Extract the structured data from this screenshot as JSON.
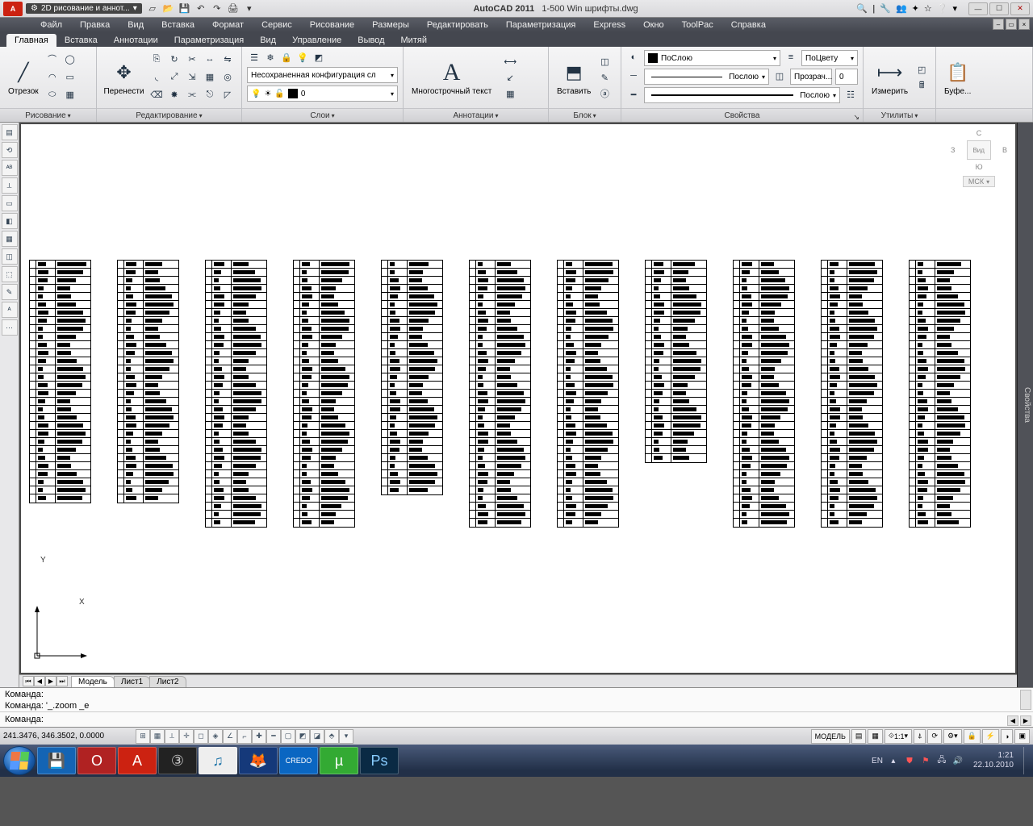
{
  "title": {
    "app": "AutoCAD 2011",
    "file": "1-500 Win шрифты.dwg",
    "logo": "A"
  },
  "workspace": {
    "text": "2D рисование и аннот..."
  },
  "menus": [
    "Файл",
    "Правка",
    "Вид",
    "Вставка",
    "Формат",
    "Сервис",
    "Рисование",
    "Размеры",
    "Редактировать",
    "Параметризация",
    "Express",
    "Окно",
    "ToolPac",
    "Справка"
  ],
  "ribtabs": [
    "Главная",
    "Вставка",
    "Аннотации",
    "Параметризация",
    "Вид",
    "Управление",
    "Вывод",
    "Митяй"
  ],
  "panels": {
    "draw": {
      "label": "Рисование",
      "big": "Отрезок"
    },
    "edit": {
      "label": "Редактирование",
      "big": "Перенести"
    },
    "layers": {
      "label": "Слои",
      "config": "Несохраненная конфигурация сл",
      "cur": "0"
    },
    "annot": {
      "label": "Аннотации",
      "big1": "A",
      "big1lbl": "Многострочный текст"
    },
    "block": {
      "label": "Блок",
      "big": "Вставить"
    },
    "props": {
      "label": "Свойства",
      "bylayer": "ПоСлою",
      "line1": "Послою",
      "line2": "Послою",
      "bycolor": "ПоЦвету",
      "transp": "Прозрач...",
      "transpv": "0"
    },
    "util": {
      "label": "Утилиты",
      "big": "Измерить"
    },
    "clip": {
      "label": "Буфе..."
    }
  },
  "viewcube": {
    "n": "С",
    "s": "Ю",
    "e": "В",
    "w": "З",
    "top": "Вид",
    "ucs": "МСК"
  },
  "layouts": {
    "model": "Модель",
    "l1": "Лист1",
    "l2": "Лист2"
  },
  "cmd": {
    "p1": "Команда:",
    "p2": "Команда: '_.zoom _e",
    "prompt": "Команда:"
  },
  "status": {
    "coords": "241.3476, 346.3502, 0.0000",
    "model": "МОДЕЛЬ",
    "scale": "1:1"
  },
  "rightpanel": "Свойства",
  "tray": {
    "lang": "EN",
    "time": "1:21",
    "date": "22.10.2010"
  },
  "axes": {
    "x": "X",
    "y": "Y"
  }
}
